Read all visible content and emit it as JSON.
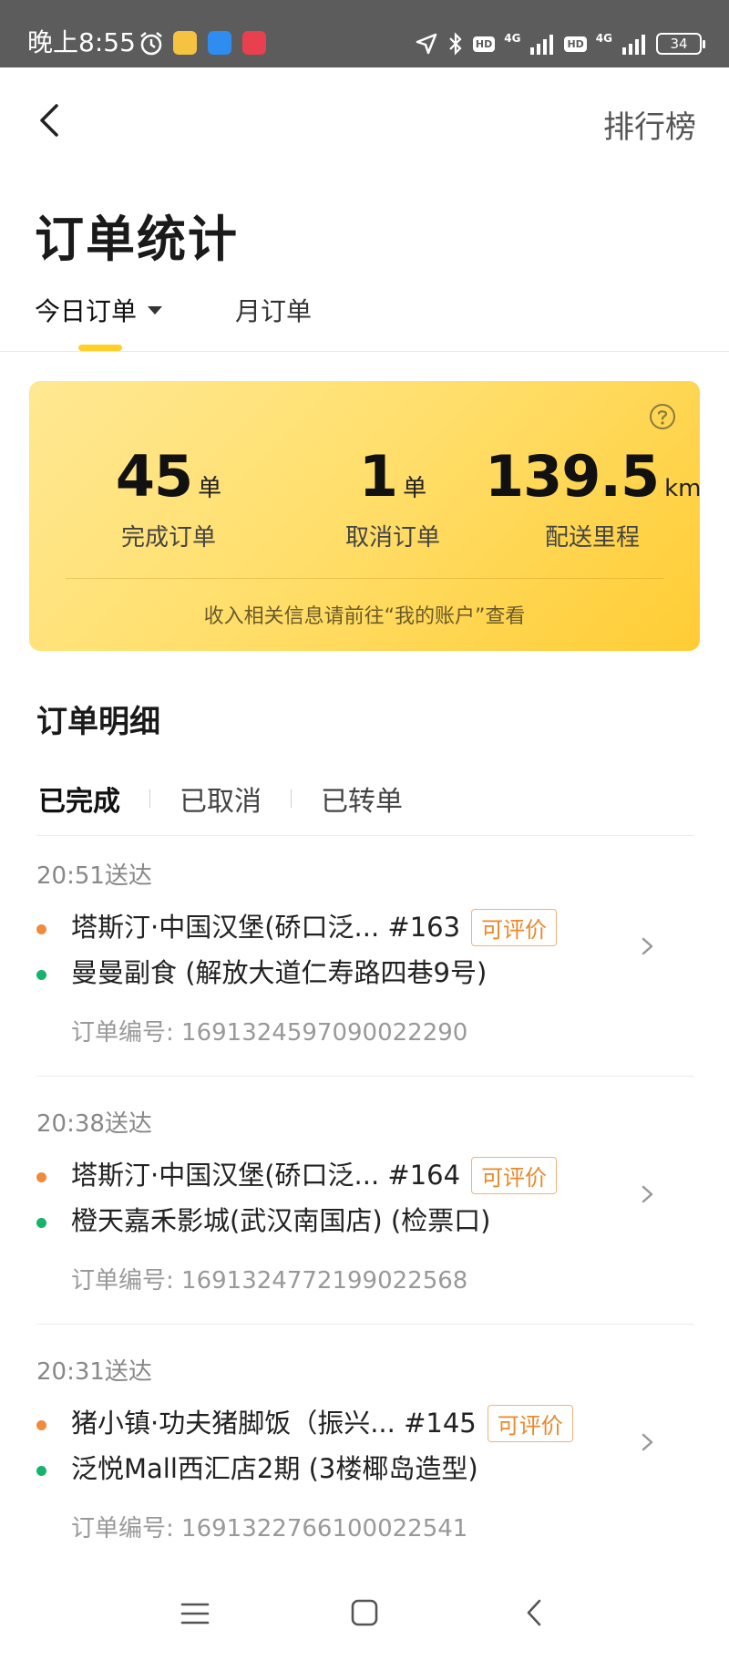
{
  "status_bar": {
    "time": "晚上8:55",
    "hd1": "HD",
    "net1": "4G",
    "hd2": "HD",
    "net2": "4G",
    "battery": "34"
  },
  "header": {
    "right_link": "排行榜",
    "title": "订单统计"
  },
  "tabs": {
    "today": "今日订单",
    "month": "月订单"
  },
  "summary": {
    "completed": {
      "value": "45",
      "unit": "单",
      "label": "完成订单"
    },
    "cancelled": {
      "value": "1",
      "unit": "单",
      "label": "取消订单"
    },
    "distance": {
      "value": "139.5",
      "unit": "km",
      "label": "配送里程"
    },
    "note": "收入相关信息请前往“我的账户”查看"
  },
  "details": {
    "title": "订单明细",
    "filters": [
      "已完成",
      "已取消",
      "已转单"
    ]
  },
  "orders": [
    {
      "time": "20:51送达",
      "shop": "塔斯汀·中国汉堡(硚口泛... #163",
      "tag": "可评价",
      "address": "曼曼副食 (解放大道仁寿路四巷9号)",
      "order_no": "订单编号: 1691324597090022290"
    },
    {
      "time": "20:38送达",
      "shop": "塔斯汀·中国汉堡(硚口泛... #164",
      "tag": "可评价",
      "address": "橙天嘉禾影城(武汉南国店) (检票口)",
      "order_no": "订单编号: 1691324772199022568"
    },
    {
      "time": "20:31送达",
      "shop": "猪小镇·功夫猪脚饭（振兴... #145",
      "tag": "可评价",
      "address": "泛悦Mall西汇店2期 (3楼椰岛造型)",
      "order_no": "订单编号: 1691322766100022541"
    }
  ],
  "colors": {
    "accent_yellow": "#ffd027",
    "tag_orange": "#e8892b",
    "pickup_dot": "#f08a3c",
    "dropoff_dot": "#16b36a"
  }
}
